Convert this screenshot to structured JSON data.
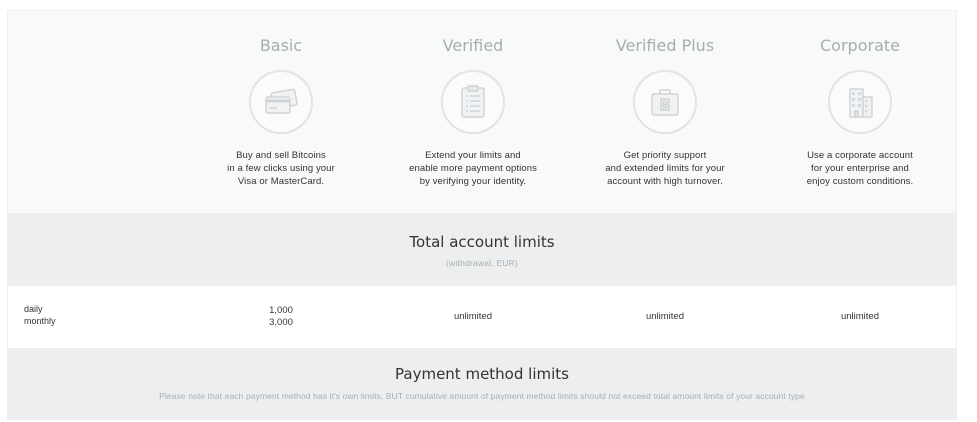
{
  "plans": [
    {
      "title": "Basic",
      "icon": "credit-cards-icon",
      "description": "Buy and sell Bitcoins\nin a few clicks using your\nVisa or MasterCard."
    },
    {
      "title": "Verified",
      "icon": "clipboard-icon",
      "description": "Extend your limits and\nenable more payment options\nby verifying your identity."
    },
    {
      "title": "Verified Plus",
      "icon": "briefcase-bitcoin-icon",
      "description": "Get priority support\nand extended limits for your\naccount with high turnover."
    },
    {
      "title": "Corporate",
      "icon": "office-building-icon",
      "description": "Use a corporate account\nfor your enterprise and\nenjoy custom conditions."
    }
  ],
  "account_limits": {
    "title": "Total account limits",
    "subtitle": "(withdrawal, EUR)",
    "row_labels": [
      "daily",
      "monthly"
    ],
    "basic": [
      "1,000",
      "3,000"
    ],
    "verified": "unlimited",
    "verified_plus": "unlimited",
    "corporate": "unlimited"
  },
  "payment_limits": {
    "title": "Payment method limits",
    "note": "Please note that each payment method has it's own limits, BUT cumulative amount of payment method limits should not exceed total amount limits of your account type"
  },
  "colors": {
    "title_gray": "#a8adb0",
    "band_bg": "#eceeef",
    "header_bg": "#f8f9f9",
    "text": "#333333"
  }
}
